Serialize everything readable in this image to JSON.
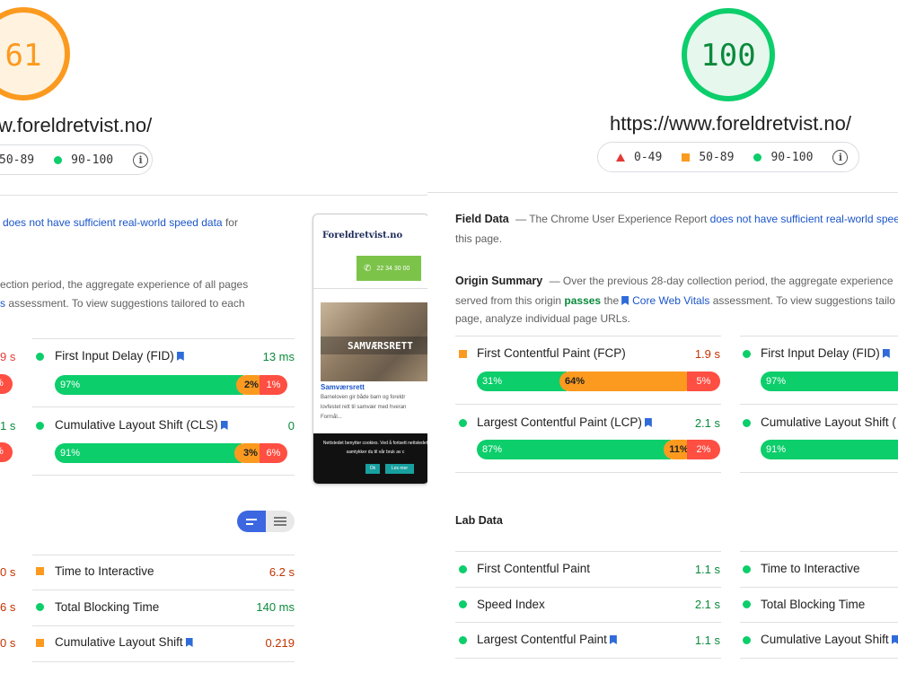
{
  "left": {
    "score": "61",
    "url": "w.foreldretvist.no/",
    "legend": {
      "mid": "50-89",
      "high": "90-100"
    },
    "field_line1_link": "does not have sufficient real-world speed data",
    "field_line1_tail": "for",
    "origin_line1": "ection period, the aggregate experience of all pages",
    "origin_line2_link": "s",
    "origin_line2_tail": "assessment. To view suggestions tailored to each",
    "cut_vals": [
      "9 s",
      "%",
      "1 s",
      "%",
      "0 s",
      "6 s",
      "0 s"
    ],
    "field_metrics": [
      {
        "name": "First Input Delay (FID)",
        "value": "13 ms",
        "bar": [
          "97%",
          "2%",
          "1%"
        ]
      },
      {
        "name": "Cumulative Layout Shift (CLS)",
        "value": "0",
        "bar": [
          "91%",
          "3%",
          "6%"
        ]
      }
    ],
    "lab_metrics": [
      {
        "name": "Time to Interactive",
        "value": "6.2 s"
      },
      {
        "name": "Total Blocking Time",
        "value": "140 ms"
      },
      {
        "name": "Cumulative Layout Shift",
        "value": "0.219"
      }
    ],
    "phone": {
      "logo": "Foreldretvist.no",
      "phone_number": "22 34 30 00",
      "hero_text": "SAMVÆRSRETT",
      "article_title": "Samværsrett",
      "article_body": "Barneloven gir både barn og foreldr lovfestet rett til samvær med hveran Formål...",
      "cookie_text": "Nettstedet benytter cookies. Ved å fortsett nettstedet samtykker du til vår bruk av c",
      "ok": "Ok",
      "read_more": "Les mer"
    }
  },
  "right": {
    "score": "100",
    "url": "https://www.foreldretvist.no/",
    "legend": {
      "low": "0-49",
      "mid": "50-89",
      "high": "90-100"
    },
    "field_title": "Field Data",
    "field_desc": "— The Chrome User Experience Report",
    "field_link": "does not have sufficient real-world speed",
    "field_tail": "this page.",
    "origin_title": "Origin Summary",
    "origin_desc": "— Over the previous 28-day collection period, the aggregate experience",
    "origin_line2_pre": "served from this origin",
    "origin_pass": "passes",
    "origin_the": "the",
    "origin_link": "Core Web Vitals",
    "origin_line2_tail": "assessment. To view suggestions tailo",
    "origin_line3": "page, analyze individual page URLs.",
    "field_metrics": [
      {
        "name": "First Contentful Paint (FCP)",
        "value": "1.9 s",
        "bar": [
          "31%",
          "64%",
          "5%"
        ]
      },
      {
        "name": "Largest Contentful Paint (LCP)",
        "value": "2.1 s",
        "bar": [
          "87%",
          "11%",
          "2%"
        ]
      }
    ],
    "field_metrics_right": [
      {
        "name": "First Input Delay (FID)",
        "bar": "97%"
      },
      {
        "name": "Cumulative Layout Shift (",
        "bar": "91%"
      }
    ],
    "lab_title": "Lab Data",
    "lab_left": [
      {
        "name": "First Contentful Paint",
        "value": "1.1 s"
      },
      {
        "name": "Speed Index",
        "value": "2.1 s"
      },
      {
        "name": "Largest Contentful Paint",
        "value": "1.1 s"
      }
    ],
    "lab_right": [
      {
        "name": "Time to Interactive"
      },
      {
        "name": "Total Blocking Time"
      },
      {
        "name": "Cumulative Layout Shift"
      }
    ]
  },
  "colors": {
    "pass": "#0cce6b",
    "average": "#fb9a1f",
    "fail": "#ff4e42",
    "link": "#1a55c9"
  }
}
